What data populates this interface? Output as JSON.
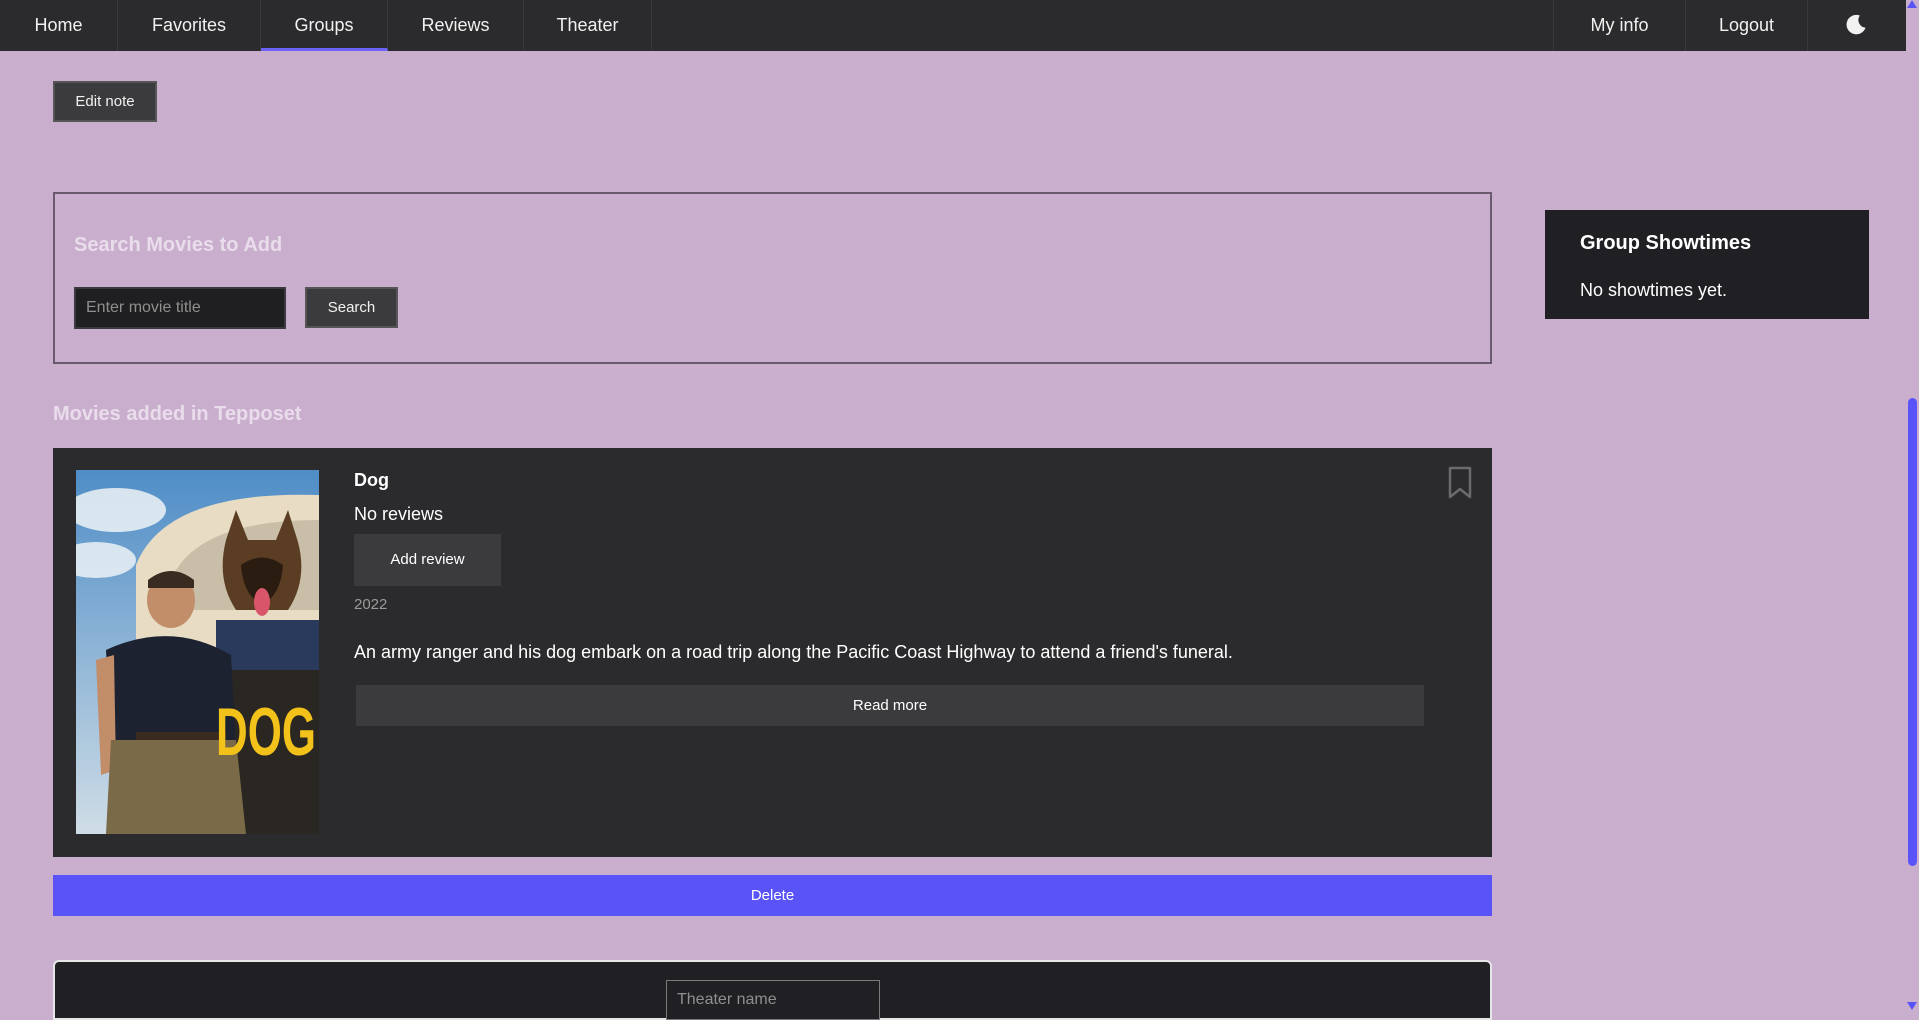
{
  "nav": {
    "items": [
      {
        "label": "Home"
      },
      {
        "label": "Favorites"
      },
      {
        "label": "Groups"
      },
      {
        "label": "Reviews"
      },
      {
        "label": "Theater"
      }
    ],
    "active": "Groups",
    "right_items": [
      {
        "label": "My info"
      },
      {
        "label": "Logout"
      }
    ],
    "theme_icon": "moon-icon"
  },
  "note": {
    "edit_label": "Edit note"
  },
  "search": {
    "title": "Search Movies to Add",
    "placeholder": "Enter movie title",
    "button_label": "Search"
  },
  "showtimes": {
    "title": "Group Showtimes",
    "empty_text": "No showtimes yet."
  },
  "movies_section": {
    "title": "Movies added in Tepposet"
  },
  "movie": {
    "title": "Dog",
    "reviews": "No reviews",
    "add_review_label": "Add review",
    "year": "2022",
    "description": "An army ranger and his dog embark on a road trip along the Pacific Coast Highway to attend a friend's funeral.",
    "read_more_label": "Read more",
    "poster_text": "DOG",
    "bookmark_icon": "bookmark-icon"
  },
  "delete_label": "Delete",
  "theater": {
    "placeholder": "Theater name"
  },
  "colors": {
    "background": "#c9aecd",
    "nav": "#2b2b2d",
    "card": "#2b2b2d",
    "accent": "#5a53f7"
  }
}
